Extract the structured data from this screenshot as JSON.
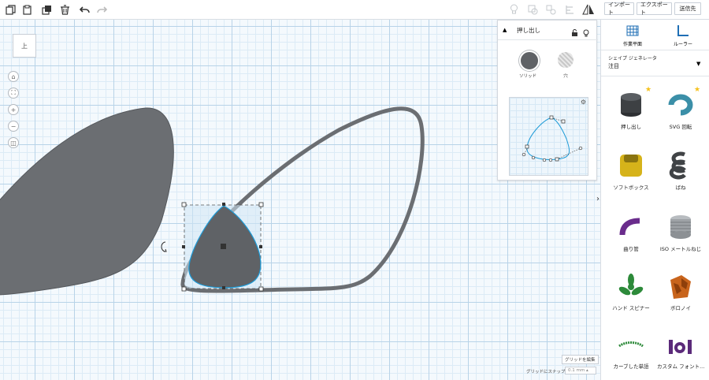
{
  "toolbar": {
    "copy_icon": "copy-icon",
    "paste_icon": "paste-icon",
    "duplicate_icon": "duplicate-icon",
    "delete_icon": "trash-icon",
    "undo_icon": "undo-icon",
    "redo_icon": "redo-icon",
    "import_label": "インポート",
    "export_label": "エクスポート",
    "send_label": "送信先"
  },
  "viewcube": {
    "label": "上"
  },
  "shape_panel": {
    "title": "押し出し",
    "solid_label": "ソリッド",
    "hole_label": "穴"
  },
  "right_panel": {
    "workplane_label": "作業平面",
    "ruler_label": "ルーラー",
    "generator_title": "シェイプ ジェネレータ",
    "generator_value": "注目",
    "items": [
      {
        "label": "押し出し"
      },
      {
        "label": "SVG 回転"
      },
      {
        "label": "ソフトボックス"
      },
      {
        "label": "ばね"
      },
      {
        "label": "曲り管"
      },
      {
        "label": "ISO メートルねじ"
      },
      {
        "label": "ハンド スピナー"
      },
      {
        "label": "ボロノイ"
      },
      {
        "label": "カーブした単語"
      },
      {
        "label": "カスタム フォント..."
      }
    ]
  },
  "footer": {
    "edit_grid": "グリッドを編集",
    "snap_label": "グリッドにスナップ",
    "snap_value": "0.1 mm"
  },
  "colors": {
    "accent": "#1e9bd7",
    "shape_gray": "#6a6d70",
    "grid": "#b8d3e8"
  }
}
